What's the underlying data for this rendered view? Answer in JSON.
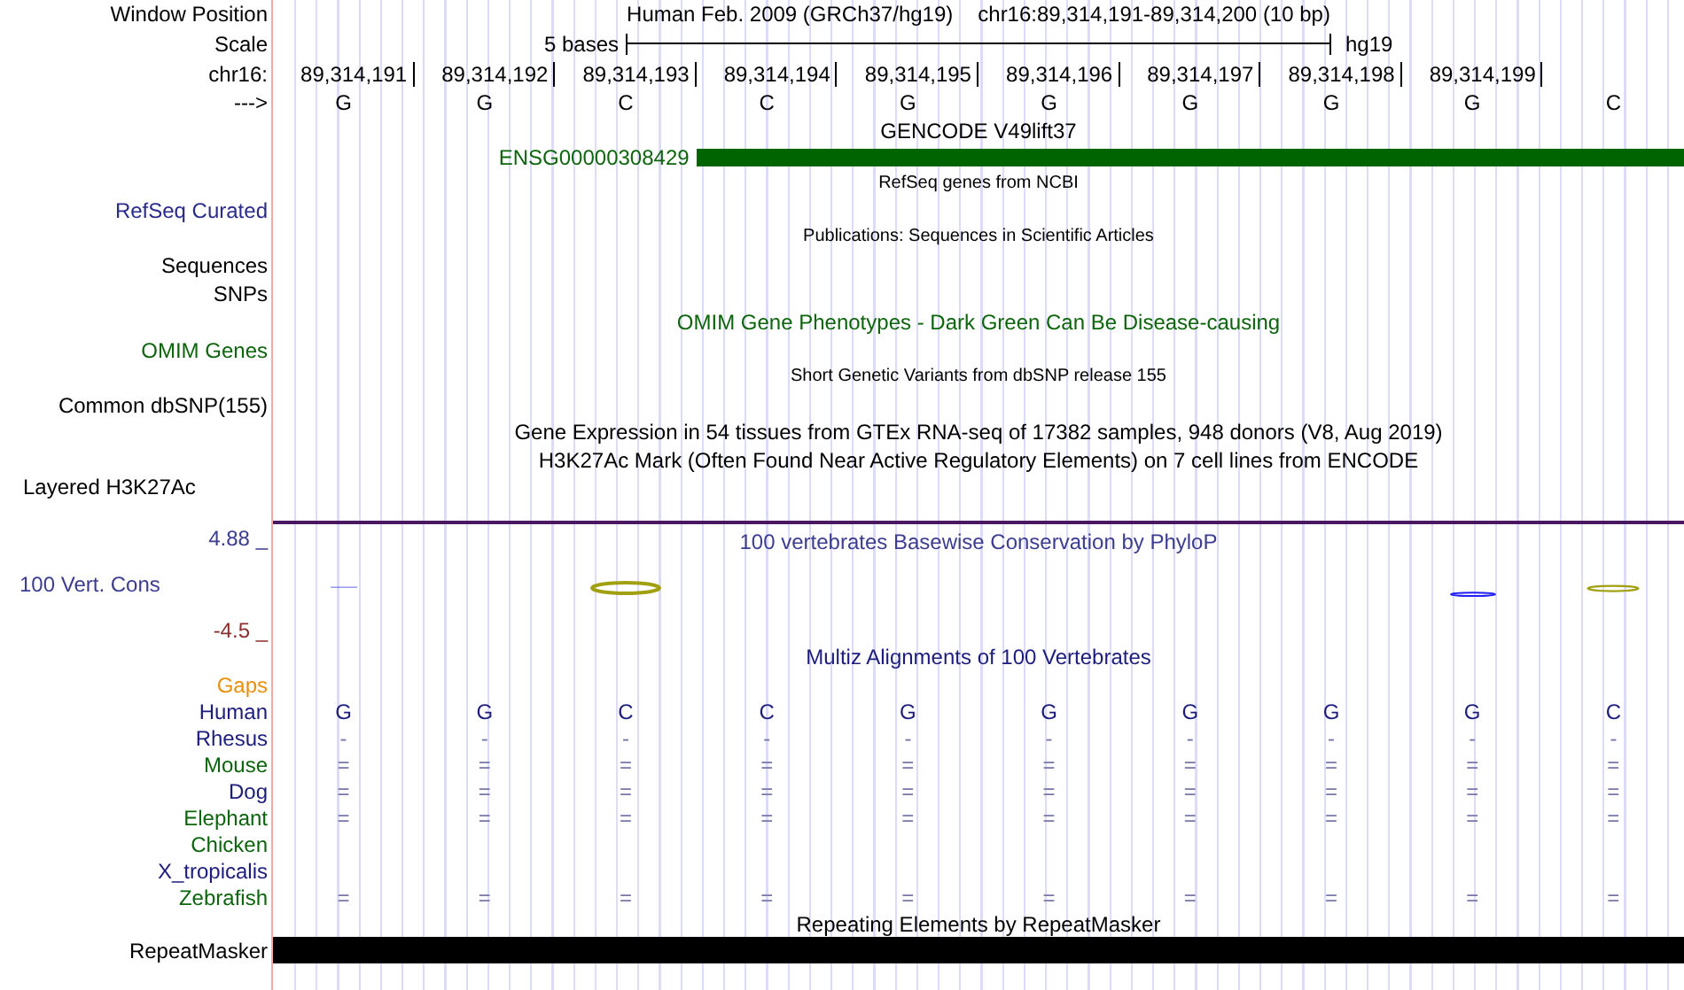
{
  "header": {
    "label": "Window Position",
    "assembly": "Human Feb. 2009 (GRCh37/hg19)",
    "position": "chr16:89,314,191-89,314,200 (10 bp)"
  },
  "scale": {
    "label": "Scale",
    "length": "5 bases",
    "db": "hg19"
  },
  "ruler": {
    "label": "chr16:",
    "positions": [
      "89,314,191",
      "89,314,192",
      "89,314,193",
      "89,314,194",
      "89,314,195",
      "89,314,196",
      "89,314,197",
      "89,314,198",
      "89,314,199"
    ]
  },
  "sequence": {
    "label": "--->",
    "bases": [
      "G",
      "G",
      "C",
      "C",
      "G",
      "G",
      "G",
      "G",
      "G",
      "C"
    ]
  },
  "gencode": {
    "title": "GENCODE V49lift37",
    "gene": "ENSG00000308429"
  },
  "refseq": {
    "title": "RefSeq genes from NCBI",
    "label": "RefSeq Curated"
  },
  "publications": {
    "title": "Publications: Sequences in Scientific Articles",
    "labels": [
      "Sequences",
      "SNPs"
    ]
  },
  "omim": {
    "title": "OMIM Gene Phenotypes - Dark Green Can Be Disease-causing",
    "label": "OMIM Genes"
  },
  "dbsnp": {
    "title": "Short Genetic Variants from dbSNP release 155",
    "label": "Common dbSNP(155)"
  },
  "gtex": {
    "title": "Gene Expression in 54 tissues from GTEx RNA-seq of 17382 samples, 948 donors (V8, Aug 2019)"
  },
  "h3k27ac": {
    "title": "H3K27Ac Mark (Often Found Near Active Regulatory Elements) on 7 cell lines from ENCODE",
    "label": "Layered H3K27Ac"
  },
  "conservation": {
    "max": "4.88 _",
    "label": "100 Vert. Cons",
    "min": "-4.5 _",
    "title": "100 vertebrates Basewise Conservation by PhyloP"
  },
  "multiz": {
    "title": "Multiz Alignments of 100 Vertebrates",
    "gaps_label": "Gaps",
    "species": [
      {
        "name": "Human",
        "color": "#1c1c7c",
        "bases": [
          "G",
          "G",
          "C",
          "C",
          "G",
          "G",
          "G",
          "G",
          "G",
          "C"
        ]
      },
      {
        "name": "Rhesus",
        "color": "#1c1c7c",
        "bases": [
          "-",
          "-",
          "-",
          "-",
          "-",
          "-",
          "-",
          "-",
          "-",
          "-"
        ]
      },
      {
        "name": "Mouse",
        "color": "#0c640c",
        "bases": [
          "=",
          "=",
          "=",
          "=",
          "=",
          "=",
          "=",
          "=",
          "=",
          "="
        ]
      },
      {
        "name": "Dog",
        "color": "#1c1c7c",
        "bases": [
          "=",
          "=",
          "=",
          "=",
          "=",
          "=",
          "=",
          "=",
          "=",
          "="
        ]
      },
      {
        "name": "Elephant",
        "color": "#0c640c",
        "bases": [
          "=",
          "=",
          "=",
          "=",
          "=",
          "=",
          "=",
          "=",
          "=",
          "="
        ]
      },
      {
        "name": "Chicken",
        "color": "#0c640c"
      },
      {
        "name": "X_tropicalis",
        "color": "#1c1c7c"
      },
      {
        "name": "Zebrafish",
        "color": "#0c640c",
        "bases": [
          "=",
          "=",
          "=",
          "=",
          "=",
          "=",
          "=",
          "=",
          "=",
          "="
        ]
      }
    ]
  },
  "repeatmasker": {
    "title": "Repeating Elements by RepeatMasker",
    "label": "RepeatMasker"
  }
}
